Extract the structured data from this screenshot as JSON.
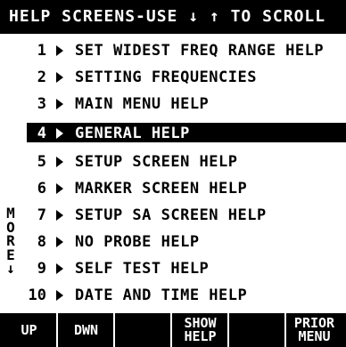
{
  "title": "HELP SCREENS-USE ↓ ↑ TO SCROLL",
  "more": [
    "M",
    "O",
    "R",
    "E",
    "↓"
  ],
  "items": [
    {
      "num": "1",
      "label": "SET WIDEST FREQ RANGE HELP"
    },
    {
      "num": "2",
      "label": "SETTING FREQUENCIES"
    },
    {
      "num": "3",
      "label": "MAIN MENU HELP"
    },
    {
      "num": "4",
      "label": "GENERAL HELP"
    },
    {
      "num": "5",
      "label": "SETUP SCREEN HELP"
    },
    {
      "num": "6",
      "label": "MARKER SCREEN HELP"
    },
    {
      "num": "7",
      "label": "SETUP SA SCREEN HELP"
    },
    {
      "num": "8",
      "label": "NO PROBE HELP"
    },
    {
      "num": "9",
      "label": "SELF TEST HELP"
    },
    {
      "num": "10",
      "label": "DATE AND TIME HELP"
    }
  ],
  "selected_index": 3,
  "softkeys": [
    {
      "line1": "UP",
      "line2": ""
    },
    {
      "line1": "DWN",
      "line2": ""
    },
    {
      "line1": "",
      "line2": ""
    },
    {
      "line1": "SHOW",
      "line2": "HELP"
    },
    {
      "line1": "",
      "line2": ""
    },
    {
      "line1": "PRIOR",
      "line2": "MENU"
    }
  ],
  "colors": {
    "background": "#ffffff",
    "foreground": "#000000",
    "inverse_text": "#ffffff"
  }
}
